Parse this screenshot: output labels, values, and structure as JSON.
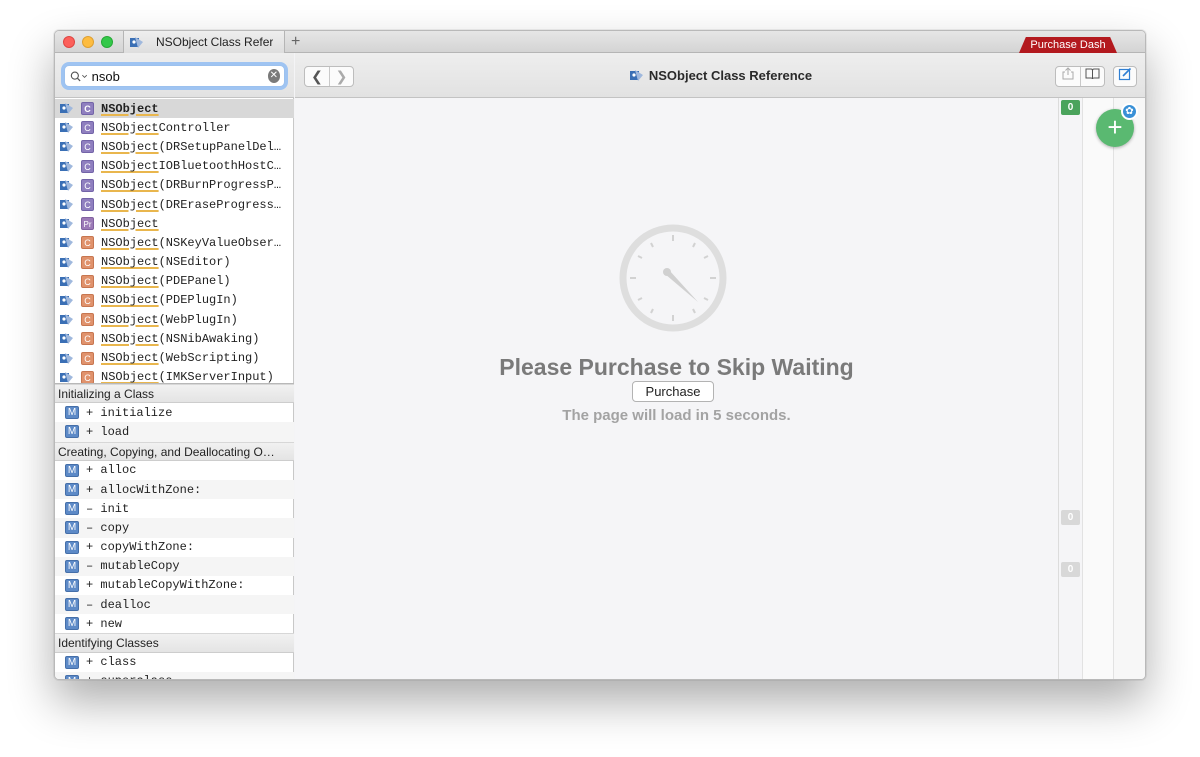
{
  "tab": {
    "title": "NSObject Class Refer",
    "new_tab_glyph": "+"
  },
  "purchase_dash": {
    "label": "Purchase Dash",
    "color": "#b3191e"
  },
  "search": {
    "value": "nsob",
    "icon": "magnifier-icon",
    "clear_icon": "clear-icon"
  },
  "results": [
    {
      "name": "NSObject",
      "rest": "",
      "kind": "C"
    },
    {
      "name": "NSObject",
      "rest": "Controller",
      "kind": "C"
    },
    {
      "name": "NSObject",
      "rest": "(DRSetupPanelDel…",
      "kind": "C"
    },
    {
      "name": "NSObject",
      "rest": "IOBluetoothHostC…",
      "kind": "C"
    },
    {
      "name": "NSObject",
      "rest": "(DRBurnProgressP…",
      "kind": "C"
    },
    {
      "name": "NSObject",
      "rest": "(DREraseProgress…",
      "kind": "C"
    },
    {
      "name": "NSObject",
      "rest": "",
      "kind": "Pr"
    },
    {
      "name": "NSObject",
      "rest": "(NSKeyValueObser…",
      "kind": "Cat"
    },
    {
      "name": "NSObject",
      "rest": "(NSEditor)",
      "kind": "Cat"
    },
    {
      "name": "NSObject",
      "rest": "(PDEPanel)",
      "kind": "Cat"
    },
    {
      "name": "NSObject",
      "rest": "(PDEPlugIn)",
      "kind": "Cat"
    },
    {
      "name": "NSObject",
      "rest": "(WebPlugIn)",
      "kind": "Cat"
    },
    {
      "name": "NSObject",
      "rest": "(NSNibAwaking)",
      "kind": "Cat"
    },
    {
      "name": "NSObject",
      "rest": "(WebScripting)",
      "kind": "Cat"
    },
    {
      "name": "NSObject",
      "rest": "(IMKServerInput)",
      "kind": "Cat"
    }
  ],
  "badges": {
    "C": "C",
    "Pr": "Pr",
    "Cat": "C",
    "M": "M"
  },
  "toc": {
    "sections": [
      {
        "title": "Initializing a Class",
        "items": [
          "+ initialize",
          "+ load"
        ]
      },
      {
        "title": "Creating, Copying, and Deallocating O…",
        "items": [
          "+ alloc",
          "+ allocWithZone:",
          "– init",
          "– copy",
          "+ copyWithZone:",
          "– mutableCopy",
          "+ mutableCopyWithZone:",
          "– dealloc",
          "+ new"
        ]
      },
      {
        "title": "Identifying Classes",
        "items": [
          "+ class",
          "+ superclass"
        ]
      }
    ]
  },
  "toolbar": {
    "back_glyph": "❮",
    "forward_glyph": "❯",
    "title": "NSObject Class Reference",
    "share_icon": "share-icon",
    "bookmark_icon": "book-icon",
    "edit_icon": "annotate-icon"
  },
  "content": {
    "heading": "Please Purchase to Skip Waiting",
    "purchase_label": "Purchase",
    "countdown": "The page will load in 5 seconds."
  },
  "annotations": {
    "count_top": "0",
    "count_mid": "0",
    "count_low": "0",
    "add_glyph": "+",
    "gear_glyph": "✿"
  }
}
